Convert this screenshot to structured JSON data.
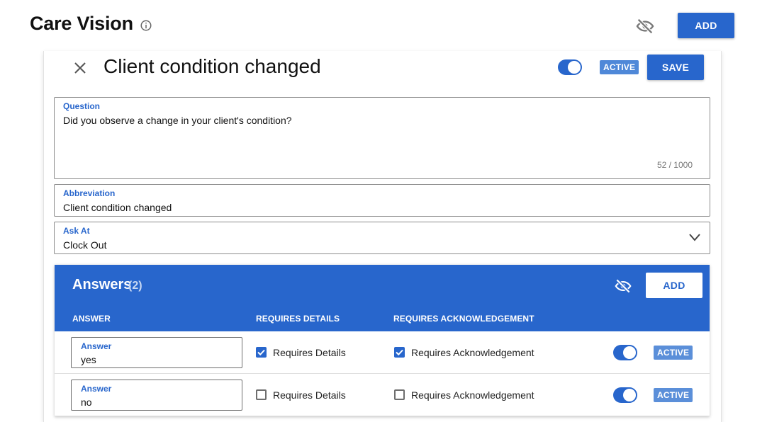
{
  "header": {
    "app_title": "Care Vision",
    "add_label": "ADD",
    "icons": {
      "info": "info-icon",
      "visibility": "eye-off-icon"
    }
  },
  "editor": {
    "title": "Client condition changed",
    "active_toggle_on": true,
    "status_badge": "ACTIVE",
    "save_label": "SAVE",
    "question": {
      "label": "Question",
      "value": "Did you observe a change in your client's condition?",
      "counter": "52 / 1000"
    },
    "abbreviation": {
      "label": "Abbreviation",
      "value": "Client condition changed"
    },
    "ask_at": {
      "label": "Ask At",
      "value": "Clock Out"
    }
  },
  "answers": {
    "title": "Answers",
    "count": "(2)",
    "add_label": "ADD",
    "columns": [
      "ANSWER",
      "REQUIRES DETAILS",
      "REQUIRES ACKNOWLEDGEMENT"
    ],
    "rows": [
      {
        "field_label": "Answer",
        "value": "yes",
        "requires_details_label": "Requires Details",
        "requires_details": true,
        "requires_ack_label": "Requires Acknowledgement",
        "requires_ack": true,
        "active": true,
        "badge": "ACTIVE"
      },
      {
        "field_label": "Answer",
        "value": "no",
        "requires_details_label": "Requires Details",
        "requires_details": false,
        "requires_ack_label": "Requires Acknowledgement",
        "requires_ack": false,
        "active": true,
        "badge": "ACTIVE"
      }
    ]
  },
  "colors": {
    "primary": "#2866cc",
    "badge": "#5b8fd9",
    "text": "#111111"
  }
}
